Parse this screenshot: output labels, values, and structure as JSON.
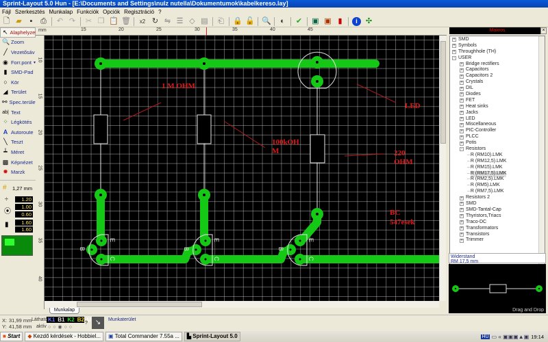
{
  "window": {
    "title": "Sprint-Layout 5.0 Hun   - [E:\\Documents and Settings\\nulz nutella\\Dokumentumok\\kabelkereso.lay]"
  },
  "menu": [
    "Fájl",
    "Szerkesztés",
    "Munkalap",
    "Funkciók",
    "Opciók",
    "Regisztráció",
    "?"
  ],
  "toolbar": {
    "icons": [
      "new-file",
      "open-folder",
      "save",
      "print",
      "undo",
      "redo",
      "cut",
      "copy",
      "paste",
      "delete",
      "x2",
      "rotate",
      "mirror",
      "align",
      "group",
      "layers",
      "import",
      "lock",
      "unlock",
      "zoom-search",
      "pacman",
      "check",
      "test",
      "drc",
      "component",
      "info",
      "connect"
    ],
    "x2_label": "x2"
  },
  "tools": [
    {
      "label": "Alaphelyzet",
      "icon": "cursor"
    },
    {
      "label": "Zoom",
      "icon": "magnifier"
    },
    {
      "label": "Vezetősáv",
      "icon": "track"
    },
    {
      "label": "Forr.pont",
      "icon": "pad"
    },
    {
      "label": "SMD-Pad",
      "icon": "smd-pad"
    },
    {
      "label": "Kör",
      "icon": "circle"
    },
    {
      "label": "Terület",
      "icon": "area"
    },
    {
      "label": "Spec.terület",
      "icon": "special-area"
    },
    {
      "label": "Text",
      "icon": "text"
    },
    {
      "label": "Légkötés",
      "icon": "airwire"
    },
    {
      "label": "Autoroute",
      "icon": "autoroute"
    },
    {
      "label": "Teszt",
      "icon": "test"
    },
    {
      "label": "Méret",
      "icon": "measure"
    },
    {
      "label": "Képnézet",
      "icon": "camera"
    },
    {
      "label": "Marzk",
      "icon": "mask"
    }
  ],
  "grid": {
    "label": "1,27 mm"
  },
  "params": {
    "track_width": "1.20",
    "pad_outer": "1.00",
    "pad_inner": "0.60",
    "smd_w": "1.60",
    "smd_h": "1.60"
  },
  "rulers": {
    "unit": "mm",
    "h": [
      "15",
      "20",
      "25",
      "30",
      "35",
      "40",
      "45"
    ],
    "v": [
      "10",
      "15",
      "20",
      "25",
      "30",
      "35",
      "40"
    ]
  },
  "canvas": {
    "annotations": [
      "1 M OHM",
      "100kOH\nM",
      "LED",
      "220\nOHM",
      "BC\n547esek"
    ],
    "pin_labels": {
      "e": "E",
      "b": "B",
      "c": "C"
    },
    "colors": {
      "copper": "#16c816",
      "silk": "#e8e8e8",
      "annotation": "#e01818",
      "background": "#000000"
    }
  },
  "sheet_tab": "Munkalap",
  "panel": {
    "title": "Makros",
    "tree": [
      {
        "label": "SMD",
        "level": 0,
        "state": "+"
      },
      {
        "label": "Symbols",
        "level": 0,
        "state": "+"
      },
      {
        "label": "Throughhole (TH)",
        "level": 0,
        "state": "+"
      },
      {
        "label": "USER",
        "level": 0,
        "state": "-"
      },
      {
        "label": "Bridge rectifiers",
        "level": 1,
        "state": "+"
      },
      {
        "label": "Capacitors",
        "level": 1,
        "state": "+"
      },
      {
        "label": "Capacitors 2",
        "level": 1,
        "state": "+"
      },
      {
        "label": "Crystals",
        "level": 1,
        "state": "+"
      },
      {
        "label": "DIL",
        "level": 1,
        "state": "+"
      },
      {
        "label": "Diodes",
        "level": 1,
        "state": "+"
      },
      {
        "label": "FET",
        "level": 1,
        "state": "+"
      },
      {
        "label": "Heat sinks",
        "level": 1,
        "state": "+"
      },
      {
        "label": "Jacks",
        "level": 1,
        "state": "+"
      },
      {
        "label": "LED",
        "level": 1,
        "state": "+"
      },
      {
        "label": "Miscellaneous",
        "level": 1,
        "state": "+"
      },
      {
        "label": "PIC-Controller",
        "level": 1,
        "state": "+"
      },
      {
        "label": "PLCC",
        "level": 1,
        "state": "+"
      },
      {
        "label": "Potis",
        "level": 1,
        "state": "+"
      },
      {
        "label": "Resistors",
        "level": 1,
        "state": "-"
      },
      {
        "label": "R (RM10).LMK",
        "level": 2
      },
      {
        "label": "R (RM12,5).LMK",
        "level": 2
      },
      {
        "label": "R (RM15).LMK",
        "level": 2
      },
      {
        "label": "R (RM17,5).LMK",
        "level": 2,
        "selected": true
      },
      {
        "label": "R (RM2,5).LMK",
        "level": 2
      },
      {
        "label": "R (RM5).LMK",
        "level": 2
      },
      {
        "label": "R (RM7,5).LMK",
        "level": 2
      },
      {
        "label": "Resistors 2",
        "level": 1,
        "state": "+"
      },
      {
        "label": "SMD",
        "level": 1,
        "state": "+"
      },
      {
        "label": "SMD-Tantal-Cap",
        "level": 1,
        "state": "+"
      },
      {
        "label": "Thyristors,Triacs",
        "level": 1,
        "state": "+"
      },
      {
        "label": "Traco-DC",
        "level": 1,
        "state": "+"
      },
      {
        "label": "Transformators",
        "level": 1,
        "state": "+"
      },
      {
        "label": "Transistors",
        "level": 1,
        "state": "+"
      },
      {
        "label": "Trimmer",
        "level": 1,
        "state": "+"
      }
    ],
    "preview_name": "Widerstand",
    "preview_desc": "RM 17,5 mm",
    "preview_hint": "Drag and Drop"
  },
  "status": {
    "x_label": "X:",
    "x": "31,99 mm",
    "y_label": "Y:",
    "y": "41,58 mm",
    "visible_label": "Látható",
    "active_label": "aktív",
    "layers": [
      "K1",
      "B1",
      "K2",
      "B2",
      "U"
    ],
    "help": "?",
    "workspace": "Munkaterület"
  },
  "taskbar": {
    "start": "Start",
    "tasks": [
      "Kezdő kérdések - Hobbiel...",
      "Total Commander 7.55a ...",
      "Sprint-Layout 5.0"
    ],
    "lang": "HU",
    "clock": "19:14"
  }
}
